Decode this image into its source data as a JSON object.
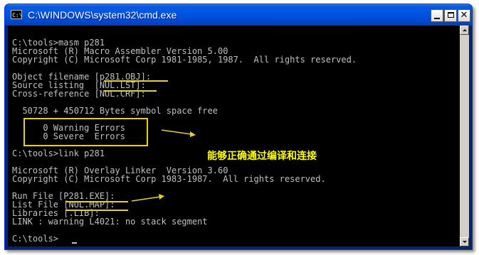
{
  "window": {
    "title": "C:\\WINDOWS\\system32\\cmd.exe",
    "icon_text": "C:\\",
    "controls": {
      "minimize": "minimize",
      "maximize": "maximize",
      "close": "✕"
    }
  },
  "console": {
    "lines": [
      "C:\\tools>masm p281",
      "Microsoft (R) Macro Assembler Version 5.00",
      "Copyright (C) Microsoft Corp 1981-1985, 1987.  All rights reserved.",
      "",
      "Object filename [p281.OBJ]:",
      "Source listing  [NUL.LST]:",
      "Cross-reference [NUL.CRF]:",
      "",
      "  50728 + 450712 Bytes symbol space free",
      "",
      "      0 Warning Errors",
      "      0 Severe  Errors",
      "",
      "C:\\tools>link p281",
      "",
      "Microsoft (R) Overlay Linker  Version 3.60",
      "Copyright (C) Microsoft Corp 1983-1987.  All rights reserved.",
      "",
      "Run File [P281.EXE]:",
      "List File [NUL.MAP]:",
      "Libraries [.LIB]:",
      "LINK : warning L4021: no stack segment",
      "",
      "C:\\tools>"
    ]
  },
  "annotation": {
    "text": "能够正确通过编译和连接"
  },
  "colors": {
    "console_bg": "#000000",
    "console_text": "#c0c0c0",
    "annotation_yellow": "#ffff00",
    "markup_yellow": "#e6d219",
    "titlebar_blue": "#0055e5"
  }
}
